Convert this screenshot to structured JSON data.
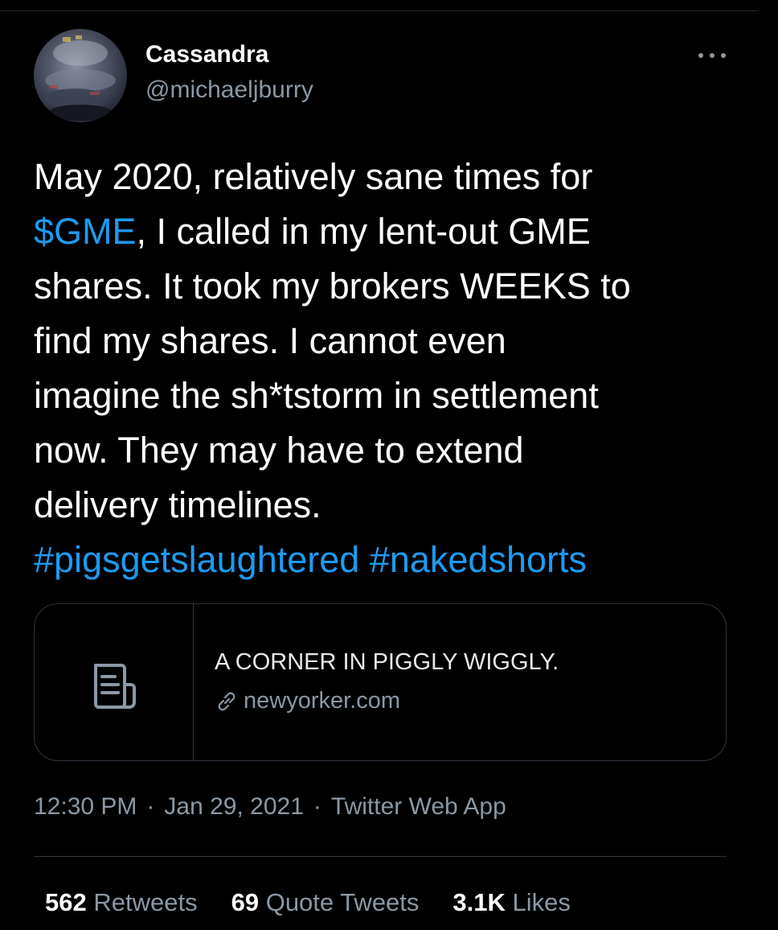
{
  "author": {
    "display_name": "Cassandra",
    "handle": "@michaeljburry"
  },
  "icons": {
    "avatar": "avatar-image",
    "more": "more-options-icon",
    "card_thumbnail": "document-icon",
    "card_link": "link-icon"
  },
  "tweet": {
    "lines": [
      [
        {
          "text": "May 2020, relatively sane times for",
          "type": "text"
        }
      ],
      [
        {
          "text": "$GME",
          "type": "link"
        },
        {
          "text": ", I called in my lent-out GME",
          "type": "text"
        }
      ],
      [
        {
          "text": "shares. It took my brokers WEEKS to",
          "type": "text"
        }
      ],
      [
        {
          "text": "find my shares.  I cannot even",
          "type": "text"
        }
      ],
      [
        {
          "text": "imagine the sh*tstorm in settlement",
          "type": "text"
        }
      ],
      [
        {
          "text": "now. They may have to extend",
          "type": "text"
        }
      ],
      [
        {
          "text": "delivery timelines.",
          "type": "text"
        }
      ],
      [
        {
          "text": "#pigsgetslaughtered",
          "type": "link"
        },
        {
          "text": " ",
          "type": "text"
        },
        {
          "text": "#nakedshorts",
          "type": "link"
        }
      ]
    ]
  },
  "card": {
    "title": "A CORNER IN PIGGLY WIGGLY.",
    "domain": "newyorker.com"
  },
  "meta": {
    "time": "12:30 PM",
    "separator": "·",
    "date": "Jan 29, 2021",
    "source": "Twitter Web App"
  },
  "stats": {
    "retweets_count": "562",
    "retweets_label": "Retweets",
    "quotes_count": "69",
    "quotes_label": "Quote Tweets",
    "likes_count": "3.1K",
    "likes_label": "Likes"
  },
  "colors": {
    "background": "#000000",
    "text": "#ffffff",
    "secondary": "#8b98a5",
    "link": "#1d9bf0",
    "border": "#2f3640"
  }
}
